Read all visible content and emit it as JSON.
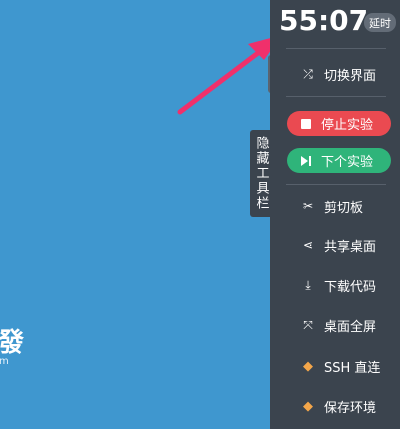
{
  "desktop": {
    "text": "發",
    "subtext": "m"
  },
  "collapse_tab": {
    "glyph": "‹"
  },
  "hide_toolbar": {
    "label": "隐藏工具栏"
  },
  "timer": {
    "value": "55:07",
    "extend_label": "延时"
  },
  "menu": {
    "switch_view": {
      "label": "切换界面",
      "icon": "shuffle-icon"
    },
    "stop": {
      "label": "停止实验",
      "icon": "stop-icon"
    },
    "next": {
      "label": "下个实验",
      "icon": "skip-next-icon"
    },
    "clipboard": {
      "label": "剪切板",
      "icon": "scissors-icon"
    },
    "share": {
      "label": "共享桌面",
      "icon": "share-icon"
    },
    "download": {
      "label": "下载代码",
      "icon": "download-icon"
    },
    "fullscreen": {
      "label": "桌面全屏",
      "icon": "fullscreen-icon"
    },
    "ssh": {
      "label": "SSH 直连",
      "icon": "gem-icon"
    },
    "save": {
      "label": "保存环境",
      "icon": "gem-icon"
    }
  },
  "colors": {
    "desktop_bg": "#3f97cf",
    "sidebar_bg": "#3b444e",
    "stop": "#ea4a51",
    "next": "#2fb47a",
    "arrow": "#f0306b",
    "gem": "#f3a64a"
  }
}
